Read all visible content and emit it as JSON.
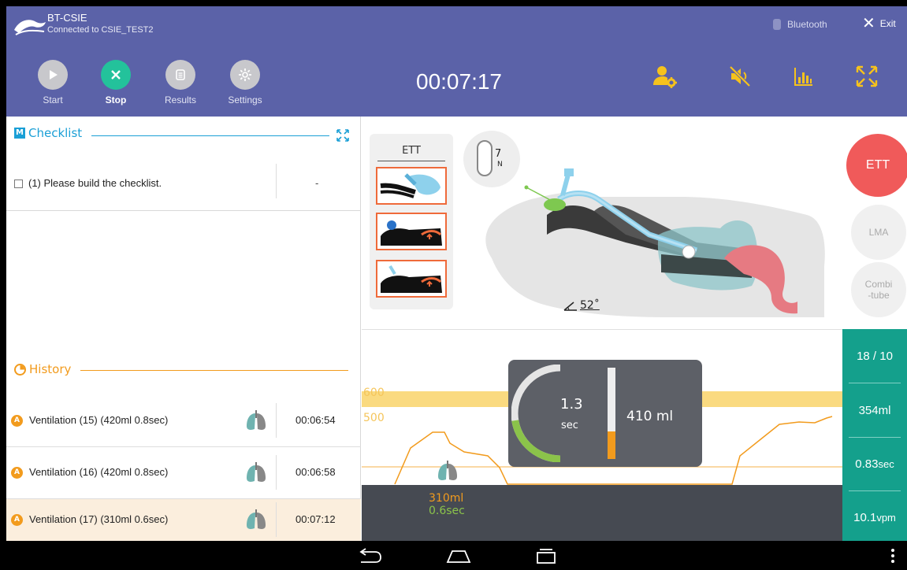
{
  "header": {
    "app_name": "BT-CSIE",
    "status": "Connected to CSIE_TEST2",
    "bluetooth_label": "Bluetooth",
    "exit_label": "Exit",
    "timer": "00:07:17",
    "toolbar": {
      "start": "Start",
      "stop": "Stop",
      "results": "Results",
      "settings": "Settings"
    },
    "icons": [
      "user-settings-icon",
      "mute-icon",
      "bar-chart-icon",
      "fullscreen-icon"
    ]
  },
  "checklist": {
    "mode_badge": "M",
    "title": "Checklist",
    "items": [
      {
        "text": "(1) Please build the checklist.",
        "value": "-"
      }
    ]
  },
  "history": {
    "title": "History",
    "badge": "A",
    "items": [
      {
        "text": "Ventilation (15) (420ml 0.8sec)",
        "time": "00:06:54"
      },
      {
        "text": "Ventilation (16) (420ml 0.8sec)",
        "time": "00:06:58"
      },
      {
        "text": "Ventilation (17) (310ml 0.6sec)",
        "time": "00:07:12"
      }
    ]
  },
  "airway": {
    "ett_title": "ETT",
    "pressure_value": "7",
    "pressure_unit": "N",
    "angle": "52˚",
    "modes": {
      "ett": "ETT",
      "lma": "LMA",
      "combitube": "Combi\n-tube"
    }
  },
  "graph": {
    "level_high": "600",
    "level_low": "500",
    "duration_value": "1.3",
    "duration_unit": "sec",
    "volume": "410 ml",
    "last_volume": "310ml",
    "last_time": "0.6sec",
    "duration_fraction": 0.45,
    "volume_fraction": 0.3
  },
  "stats": {
    "count": "18 / 10",
    "avg_volume": "354ml",
    "avg_time_value": "0.83",
    "avg_time_unit": "sec",
    "rate_value": "10.1",
    "rate_unit": "vpm"
  },
  "colors": {
    "header": "#5b62a8",
    "accent_green": "#23c29b",
    "checklist_blue": "#1a9fd6",
    "history_orange": "#f29b1d",
    "ett_red": "#f05a5a",
    "stats_teal": "#14a08c"
  }
}
